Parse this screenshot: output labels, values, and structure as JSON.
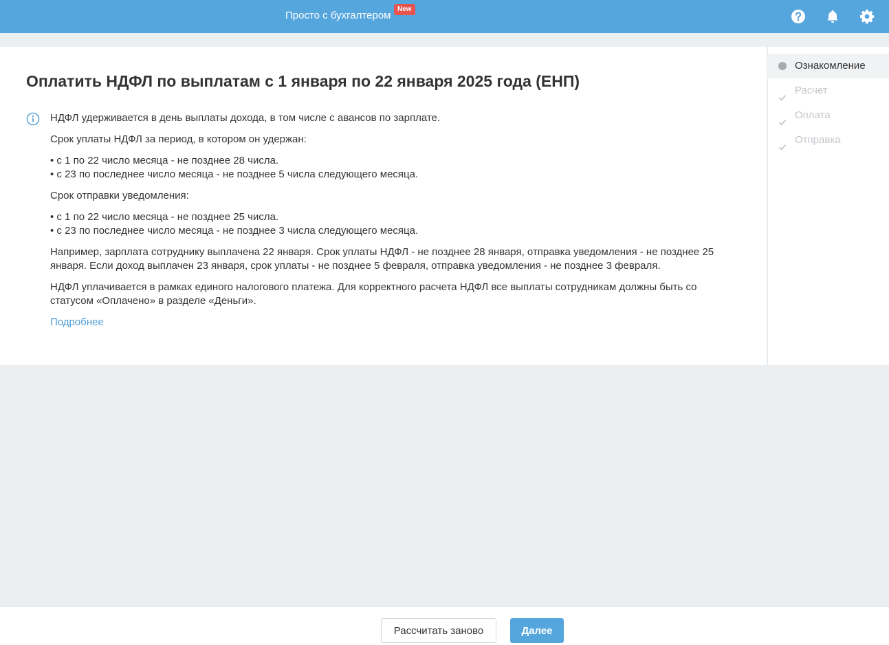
{
  "header": {
    "title": "Просто с бухгалтером",
    "badge": "New",
    "icons": [
      "help-icon",
      "bell-icon",
      "gear-icon"
    ],
    "bg_color": "#56a6de",
    "badge_color": "#e8534f"
  },
  "main": {
    "title": "Оплатить НДФЛ по выплатам с 1 января по 22 января 2025 года (ЕНП)",
    "info_icon": "info-icon",
    "paragraphs": [
      "НДФЛ удерживается в день выплаты дохода, в том числе с авансов по зарплате.",
      "Срок уплаты НДФЛ за период, в котором он удержан:",
      "• с 1 по 22 число месяца - не позднее 28 числа.",
      "• с 23 по последнее число месяца - не позднее 5 числа следующего месяца.",
      "Срок отправки уведомления:",
      "• с 1 по 22 число месяца - не позднее 25 числа.",
      "• с 23 по последнее число месяца - не позднее 3 числа следующего месяца.",
      "Например, зарплата сотруднику выплачена 22 января. Срок уплаты НДФЛ - не позднее 28 января, отправка уведомления - не позднее 25 января. Если доход выплачен 23 января, срок уплаты - не позднее 5 февраля, отправка уведомления - не позднее 3 февраля.",
      "НДФЛ уплачивается в рамках единого налогового платежа. Для корректного расчета НДФЛ все выплаты сотрудникам должны быть со статусом «Оплачено» в разделе «Деньги»."
    ],
    "more_link": "Подробнее",
    "link_color": "#4d9bd6"
  },
  "steps": [
    {
      "label": "Ознакомление",
      "state": "active"
    },
    {
      "label": "Расчет",
      "state": "pending"
    },
    {
      "label": "Оплата",
      "state": "pending"
    },
    {
      "label": "Отправка",
      "state": "pending"
    }
  ],
  "footer": {
    "recalc_label": "Рассчитать заново",
    "next_label": "Далее",
    "primary_color": "#56a6de"
  }
}
